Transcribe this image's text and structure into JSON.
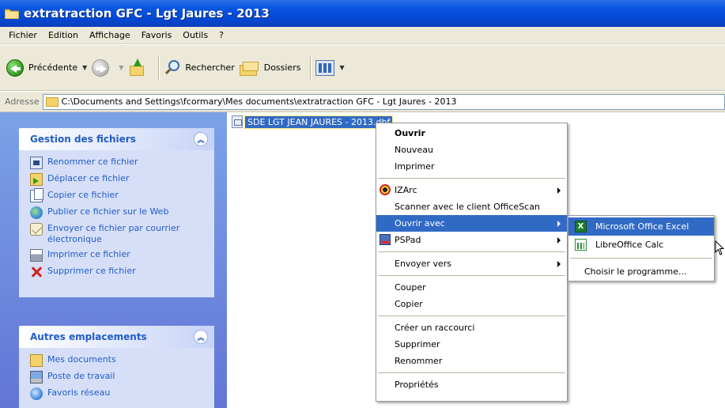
{
  "window": {
    "title": "extratraction GFC - Lgt Jaures - 2013"
  },
  "menubar": [
    "Fichier",
    "Edition",
    "Affichage",
    "Favoris",
    "Outils",
    "?"
  ],
  "toolbar": {
    "back_label": "Précédente",
    "search_label": "Rechercher",
    "folders_label": "Dossiers"
  },
  "address": {
    "label": "Adresse",
    "path": "C:\\Documents and Settings\\fcormary\\Mes documents\\extratraction GFC - Lgt Jaures - 2013"
  },
  "left_pane": {
    "file_tasks": {
      "title": "Gestion des fichiers",
      "items": [
        "Renommer ce fichier",
        "Déplacer ce fichier",
        "Copier ce fichier",
        "Publier ce fichier sur le Web",
        "Envoyer ce fichier par courrier électronique",
        "Imprimer ce fichier",
        "Supprimer ce fichier"
      ]
    },
    "other_places": {
      "title": "Autres emplacements",
      "items": [
        "Mes documents",
        "Poste de travail",
        "Favoris réseau"
      ]
    }
  },
  "file": {
    "name": "SDE LGT JEAN JAURES - 2013.dbf"
  },
  "context_menu": {
    "open": "Ouvrir",
    "new": "Nouveau",
    "print": "Imprimer",
    "izarc": "IZArc",
    "scan": "Scanner avec le client OfficeScan",
    "open_with": "Ouvrir avec",
    "pspad": "PSPad",
    "send_to": "Envoyer vers",
    "cut": "Couper",
    "copy": "Copier",
    "shortcut": "Créer un raccourci",
    "delete": "Supprimer",
    "rename": "Renommer",
    "properties": "Propriétés"
  },
  "open_with_submenu": {
    "excel": "Microsoft Office Excel",
    "calc": "LibreOffice Calc",
    "choose": "Choisir le programme..."
  },
  "colors": {
    "titlebar": "#0a55e0",
    "selection": "#316ac5",
    "task_link": "#215dc6",
    "chrome": "#ece9d8"
  }
}
